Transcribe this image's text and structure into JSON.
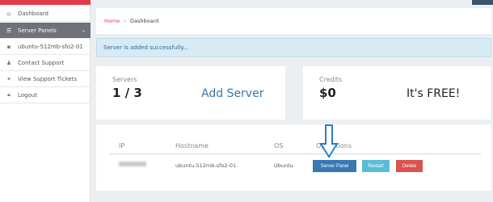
{
  "sidebar": {
    "items": [
      {
        "label": "Dashboard",
        "icon": "home-icon",
        "active": false
      },
      {
        "label": "Server Panels",
        "icon": "list-icon",
        "active": true
      },
      {
        "label": "ubuntu-512mb-sfo2-01",
        "icon": "server-icon",
        "active": false
      },
      {
        "label": "Contact Support",
        "icon": "user-icon",
        "active": false
      },
      {
        "label": "View Support Tickets",
        "icon": "ticket-icon",
        "active": false
      },
      {
        "label": "Logout",
        "icon": "lock-icon",
        "active": false
      }
    ]
  },
  "breadcrumb": {
    "home": "Home",
    "separator": "›",
    "current": "Dashboard"
  },
  "alert": {
    "text": "Server is added successfully..."
  },
  "servers_card": {
    "label": "Servers",
    "count": "1 / 3",
    "action": "Add Server"
  },
  "credits_card": {
    "label": "Credits",
    "amount": "$0",
    "note": "It's FREE!"
  },
  "table": {
    "headers": {
      "ip": "IP",
      "hostname": "Hostname",
      "os": "OS",
      "operations": "Operations"
    },
    "rows": [
      {
        "hostname": "ubuntu-512mb-sfo2-01",
        "os": "Ubuntu"
      }
    ],
    "buttons": {
      "panel": "Server Panel",
      "restart": "Restart",
      "delete": "Delete"
    }
  },
  "colors": {
    "brand_red": "#e23b4a",
    "primary_blue": "#3779b2",
    "info_blue": "#5bbcd9",
    "danger_red": "#d9534f",
    "annotation_arrow": "#2a7fc2"
  }
}
